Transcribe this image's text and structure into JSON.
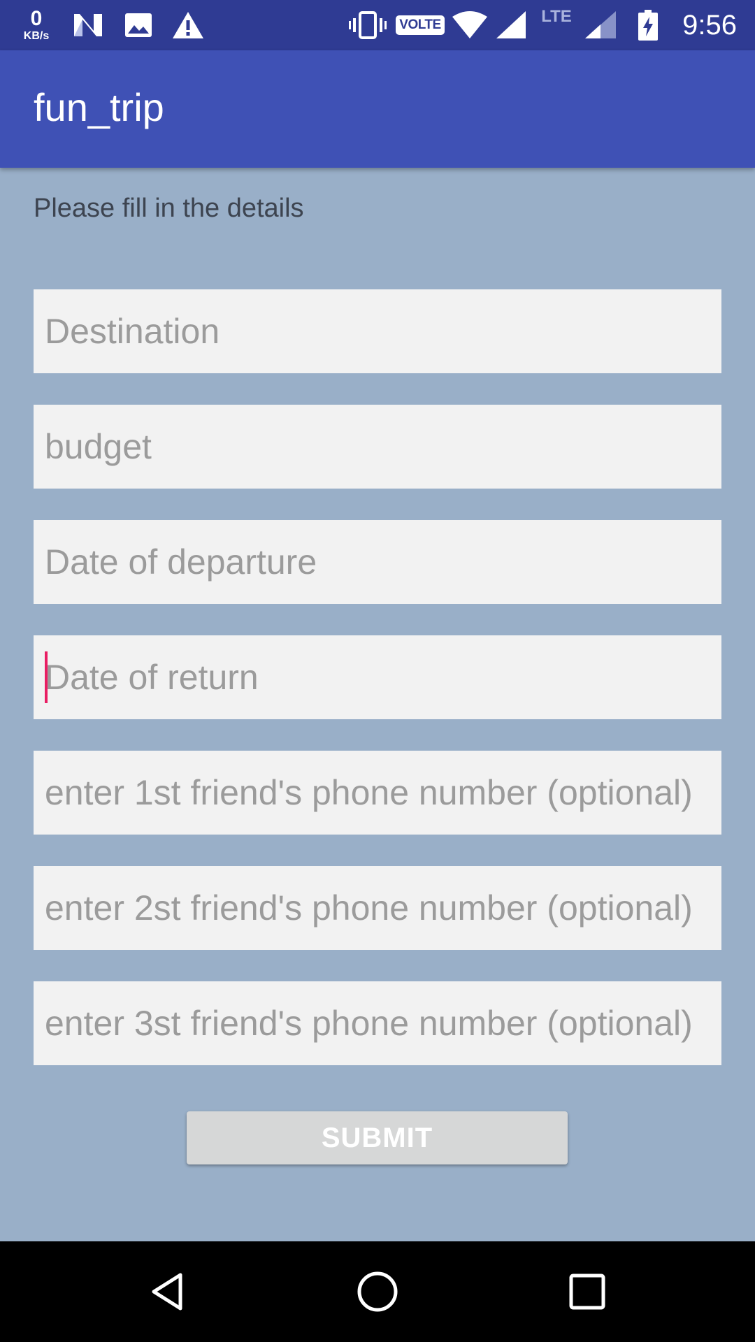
{
  "status_bar": {
    "network_speed_value": "0",
    "network_speed_unit": "KB/s",
    "volte_label": "VOLTE",
    "lte_label": "LTE",
    "time": "9:56",
    "icons": [
      "n-icon",
      "image-icon",
      "warning-icon",
      "vibrate-icon",
      "volte-icon",
      "wifi-icon",
      "signal-icon",
      "lte-signal-icon",
      "battery-charging-icon"
    ]
  },
  "app_bar": {
    "title": "fun_trip"
  },
  "form": {
    "instructions": "Please fill in the details",
    "fields": [
      {
        "placeholder": "Destination",
        "value": ""
      },
      {
        "placeholder": "budget",
        "value": ""
      },
      {
        "placeholder": "Date of departure",
        "value": ""
      },
      {
        "placeholder": "Date of return",
        "value": "",
        "focused": true
      },
      {
        "placeholder": "enter 1st friend's phone number (optional)",
        "value": ""
      },
      {
        "placeholder": "enter 2st friend's phone number (optional)",
        "value": ""
      },
      {
        "placeholder": "enter 3st friend's phone number (optional)",
        "value": ""
      }
    ],
    "submit_label": "SUBMIT"
  },
  "nav_bar": {
    "icons": [
      "back-icon",
      "home-icon",
      "recents-icon"
    ]
  },
  "colors": {
    "status_bar": "#2f3b93",
    "app_bar": "#3f51b5",
    "background": "#99afc8",
    "field_background": "#f2f2f2",
    "cursor": "#e91e63",
    "button": "#d6d7d7"
  }
}
